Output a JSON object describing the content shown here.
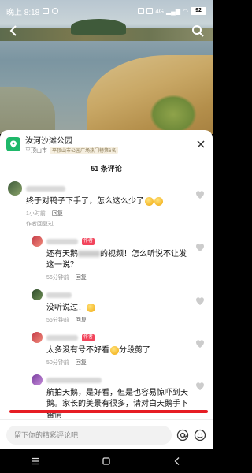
{
  "status_bar": {
    "time": "晚上 8:18",
    "network": "4G",
    "battery": "92"
  },
  "poi": {
    "name": "汝河沙滩公园",
    "city": "平顶山市",
    "rank_badge": "平顶山市公园广场热门榜第6名"
  },
  "comments_header": "51 条评论",
  "comments": [
    {
      "level": "top",
      "text_before": "终于对鸭子下手了，怎么这么少了",
      "time": "1小时前",
      "reply_label": "回复",
      "author_replied": "作者回复过",
      "emoji_count": 2
    },
    {
      "level": "reply",
      "author_tag": "作者",
      "text_before": "还有天鹅",
      "text_after": "的视频！怎么听说不让发这一说？",
      "time": "56分钟前",
      "reply_label": "回复"
    },
    {
      "level": "reply",
      "text_before": "没听说过！",
      "time": "56分钟前",
      "reply_label": "回复",
      "emoji_count": 1
    },
    {
      "level": "reply",
      "author_tag": "作者",
      "text_before": "太多没有号不好看",
      "text_after": "分段剪了",
      "time": "50分钟前",
      "reply_label": "回复"
    },
    {
      "level": "reply",
      "text_before": "航拍天鹅，是好看，但是也容易惊吓到天鹅。家长的美景有很多，请对白天鹅手下留情"
    }
  ],
  "input": {
    "placeholder": "留下你的精彩评论吧"
  },
  "colors": {
    "accent_red": "#e61d24",
    "author_tag": "#f2455c",
    "poi_green": "#1fb86a"
  }
}
